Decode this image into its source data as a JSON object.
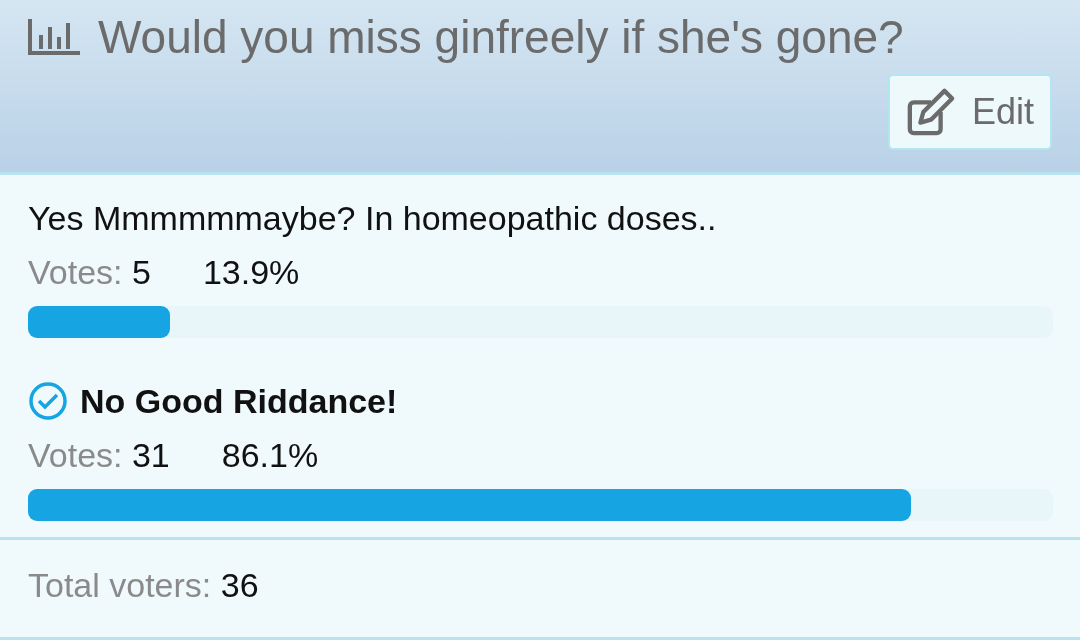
{
  "poll": {
    "title": "Would you miss ginfreely if she's gone?",
    "edit_button": "Edit",
    "options": [
      {
        "text": "Yes Mmmmmmaybe? In homeopathic doses..",
        "selected": false,
        "votes_label": "Votes:",
        "votes": "5",
        "percent": "13.9%",
        "level": 0.139
      },
      {
        "text": "No Good Riddance!",
        "selected": true,
        "votes_label": "Votes:",
        "votes": "31",
        "percent": "86.1%",
        "level": 0.861
      }
    ],
    "total_label": "Total voters:",
    "total": "36"
  }
}
